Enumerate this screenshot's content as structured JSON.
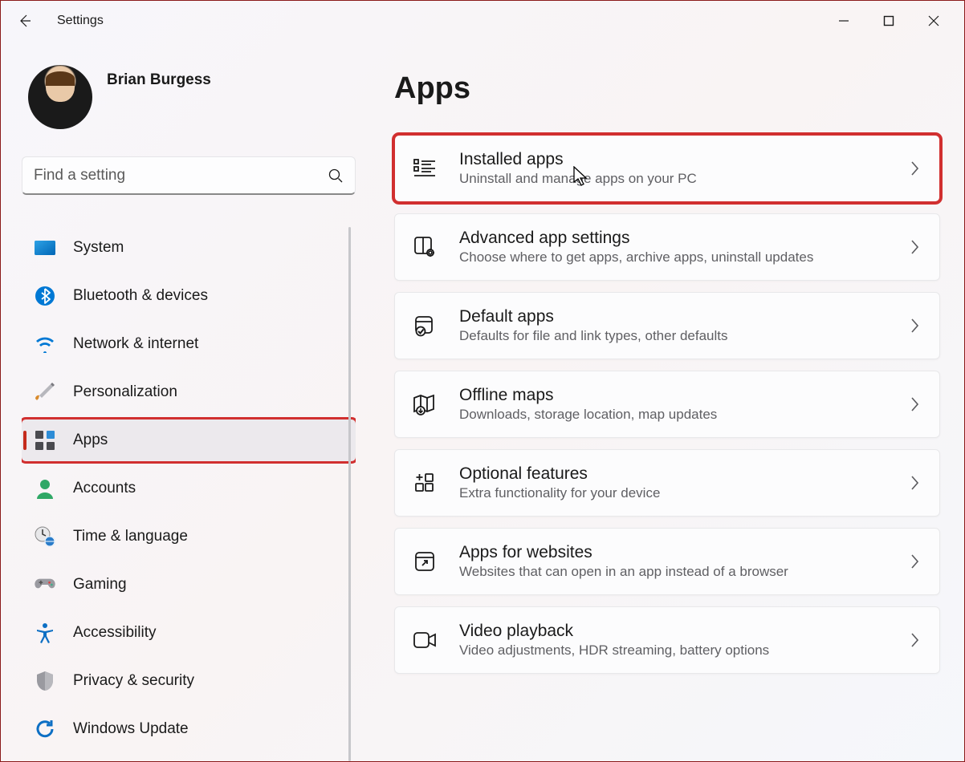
{
  "app": {
    "title": "Settings"
  },
  "profile": {
    "name": "Brian Burgess"
  },
  "search": {
    "placeholder": "Find a setting"
  },
  "nav": [
    {
      "id": "system",
      "label": "System"
    },
    {
      "id": "bluetooth",
      "label": "Bluetooth & devices"
    },
    {
      "id": "network",
      "label": "Network & internet"
    },
    {
      "id": "personalization",
      "label": "Personalization"
    },
    {
      "id": "apps",
      "label": "Apps",
      "selected": true,
      "highlighted": true
    },
    {
      "id": "accounts",
      "label": "Accounts"
    },
    {
      "id": "time",
      "label": "Time & language"
    },
    {
      "id": "gaming",
      "label": "Gaming"
    },
    {
      "id": "accessibility",
      "label": "Accessibility"
    },
    {
      "id": "privacy",
      "label": "Privacy & security"
    },
    {
      "id": "update",
      "label": "Windows Update"
    }
  ],
  "page": {
    "title": "Apps"
  },
  "cards": [
    {
      "id": "installed-apps",
      "title": "Installed apps",
      "sub": "Uninstall and manage apps on your PC",
      "highlighted": true
    },
    {
      "id": "advanced-app-settings",
      "title": "Advanced app settings",
      "sub": "Choose where to get apps, archive apps, uninstall updates"
    },
    {
      "id": "default-apps",
      "title": "Default apps",
      "sub": "Defaults for file and link types, other defaults"
    },
    {
      "id": "offline-maps",
      "title": "Offline maps",
      "sub": "Downloads, storage location, map updates"
    },
    {
      "id": "optional-features",
      "title": "Optional features",
      "sub": "Extra functionality for your device"
    },
    {
      "id": "apps-for-websites",
      "title": "Apps for websites",
      "sub": "Websites that can open in an app instead of a browser"
    },
    {
      "id": "video-playback",
      "title": "Video playback",
      "sub": "Video adjustments, HDR streaming, battery options"
    }
  ]
}
